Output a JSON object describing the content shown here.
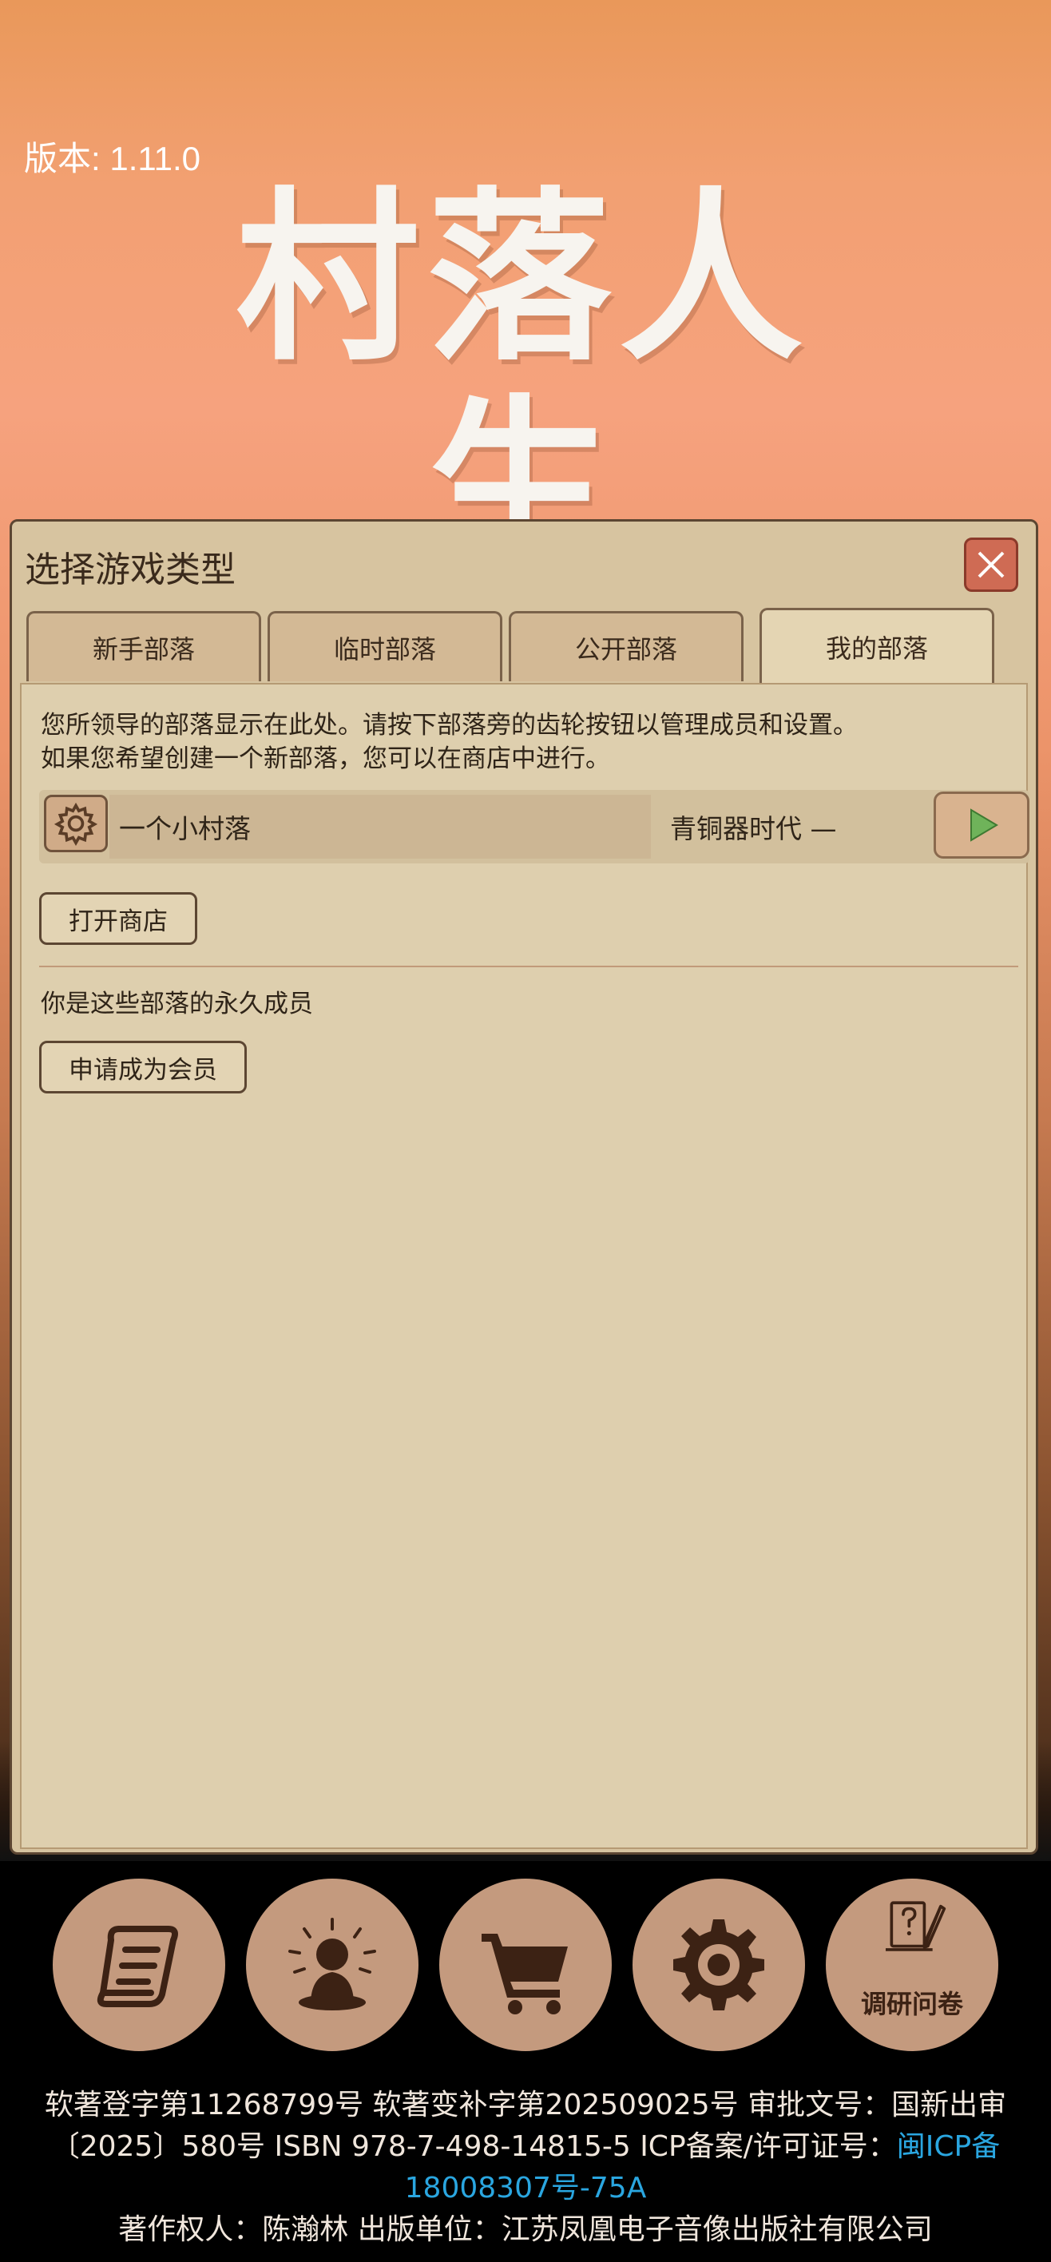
{
  "header": {
    "version": "版本: 1.11.0",
    "logo_text": "村落人生"
  },
  "dialog": {
    "title": "选择游戏类型",
    "tabs": [
      {
        "label": "新手部落",
        "active": false
      },
      {
        "label": "临时部落",
        "active": false
      },
      {
        "label": "公开部落",
        "active": false
      },
      {
        "label": "我的部落",
        "active": true
      }
    ],
    "description_line1": "您所领导的部落显示在此处。请按下部落旁的齿轮按钮以管理成员和设置。",
    "description_line2": "如果您希望创建一个新部落，您可以在商店中进行。",
    "tribe": {
      "name": "一个小村落",
      "age": "青铜器时代 —"
    },
    "open_shop_label": "打开商店",
    "members_label": "你是这些部落的永久成员",
    "apply_member_label": "申请成为会员"
  },
  "bottom_nav": {
    "items": [
      {
        "icon": "scroll-icon"
      },
      {
        "icon": "meditation-icon"
      },
      {
        "icon": "cart-icon"
      },
      {
        "icon": "gear-icon"
      },
      {
        "icon": "survey-icon",
        "label": "调研问卷"
      }
    ]
  },
  "footer": {
    "line1": "软著登字第11268799号 软著变补字第202509025号 审批文号：国新出审",
    "line2_prefix": "〔2025〕580号 ISBN 978-7-498-14815-5 ICP备案/许可证号：",
    "line2_link": "闽ICP备",
    "line3_link": "18008307号-75A",
    "line4": "著作权人：陈瀚林 出版单位：江苏凤凰电子音像出版社有限公司"
  },
  "colors": {
    "dialog_bg": "#d7c4a0",
    "panel_bg": "#decfae",
    "close_red": "#cf6b54",
    "nav_circle": "#c49a7e",
    "link_blue": "#2aa6e0"
  }
}
